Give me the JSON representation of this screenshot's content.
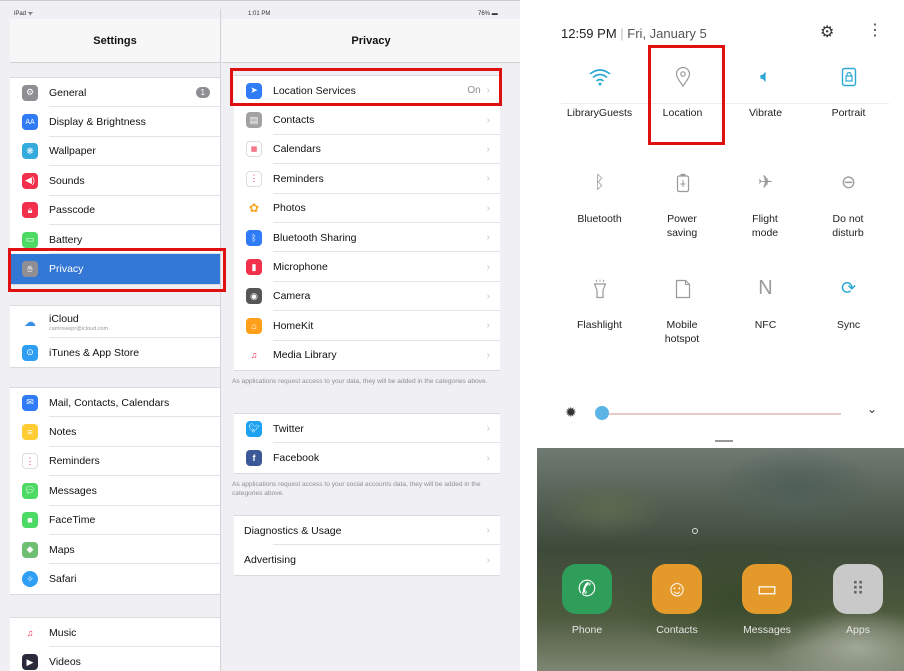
{
  "ipad": {
    "settings": {
      "status_left": "iPad ᯤ",
      "title": "Settings",
      "group1": [
        {
          "label": "General",
          "icon": "gear-icon",
          "color": "#8e8e93",
          "badge": "1"
        },
        {
          "label": "Display & Brightness",
          "icon": "aa-icon",
          "color": "#2f7cf6"
        },
        {
          "label": "Wallpaper",
          "icon": "wallpaper-icon",
          "color": "#35aadc"
        },
        {
          "label": "Sounds",
          "icon": "speaker-icon",
          "color": "#f2304b"
        },
        {
          "label": "Passcode",
          "icon": "lock-icon",
          "color": "#f2304b"
        },
        {
          "label": "Battery",
          "icon": "battery-icon",
          "color": "#4cd964"
        },
        {
          "label": "Privacy",
          "icon": "hand-icon",
          "color": "#8e8e93",
          "selected": true
        }
      ],
      "group2": [
        {
          "label": "iCloud",
          "sub": "camrowepr@icloud.com",
          "icon": "cloud-icon",
          "color": "#ffffff"
        },
        {
          "label": "iTunes & App Store",
          "icon": "app-store-icon",
          "color": "#2f9ff5"
        }
      ],
      "group3": [
        {
          "label": "Mail, Contacts, Calendars",
          "icon": "mail-icon",
          "color": "#2f7cf6"
        },
        {
          "label": "Notes",
          "icon": "notes-icon",
          "color": "#ffcc33"
        },
        {
          "label": "Reminders",
          "icon": "reminders-icon",
          "color": "#ffffff"
        },
        {
          "label": "Messages",
          "icon": "messages-icon",
          "color": "#4cd964"
        },
        {
          "label": "FaceTime",
          "icon": "facetime-icon",
          "color": "#4cd964"
        },
        {
          "label": "Maps",
          "icon": "maps-icon",
          "color": "#6fbf73"
        },
        {
          "label": "Safari",
          "icon": "safari-icon",
          "color": "#2f9ff5"
        }
      ],
      "group4": [
        {
          "label": "Music",
          "icon": "music-icon",
          "color": "#ffffff"
        },
        {
          "label": "Videos",
          "icon": "videos-icon",
          "color": "#2a2a3a"
        }
      ]
    },
    "privacy": {
      "status_time": "1:01 PM",
      "status_battery": "76%",
      "title": "Privacy",
      "group1": [
        {
          "label": "Location Services",
          "value": "On",
          "icon": "location-arrow-icon",
          "color": "#2f7cf6"
        },
        {
          "label": "Contacts",
          "icon": "contacts-icon",
          "color": "#a2a2a2"
        },
        {
          "label": "Calendars",
          "icon": "calendar-icon",
          "color": "#ffffff"
        },
        {
          "label": "Reminders",
          "icon": "reminders-icon",
          "color": "#ffffff"
        },
        {
          "label": "Photos",
          "icon": "photos-icon",
          "color": "#ffffff"
        },
        {
          "label": "Bluetooth Sharing",
          "icon": "bluetooth-icon",
          "color": "#2f7cf6"
        },
        {
          "label": "Microphone",
          "icon": "microphone-icon",
          "color": "#f2304b"
        },
        {
          "label": "Camera",
          "icon": "camera-icon",
          "color": "#555555"
        },
        {
          "label": "HomeKit",
          "icon": "home-icon",
          "color": "#ff9f1a"
        },
        {
          "label": "Media Library",
          "icon": "music-icon",
          "color": "#ffffff"
        }
      ],
      "note1": "As applications request access to your data, they will be added in the categories above.",
      "group2": [
        {
          "label": "Twitter",
          "icon": "twitter-icon",
          "color": "#1da1f2"
        },
        {
          "label": "Facebook",
          "icon": "facebook-icon",
          "color": "#3b5998"
        }
      ],
      "note2": "As applications request access to your social accounts data, they will be added in the categories above.",
      "group3": [
        {
          "label": "Diagnostics & Usage"
        },
        {
          "label": "Advertising"
        }
      ]
    }
  },
  "android": {
    "time": "12:59 PM",
    "date": "Fri, January 5",
    "tiles": [
      {
        "label": "LibraryGuests",
        "icon": "wifi-icon",
        "on": true
      },
      {
        "label": "Location",
        "icon": "location-pin-icon",
        "on": false
      },
      {
        "label": "Vibrate",
        "icon": "vibrate-icon",
        "on": true
      },
      {
        "label": "Portrait",
        "icon": "portrait-lock-icon",
        "on": true
      },
      {
        "label": "Bluetooth",
        "icon": "bluetooth-icon",
        "on": false
      },
      {
        "label": "Power saving",
        "icon": "power-saving-icon",
        "on": false
      },
      {
        "label": "Flight mode",
        "icon": "airplane-icon",
        "on": false
      },
      {
        "label": "Do not disturb",
        "icon": "do-not-disturb-icon",
        "on": false
      },
      {
        "label": "Flashlight",
        "icon": "flashlight-icon",
        "on": false
      },
      {
        "label": "Mobile hotspot",
        "icon": "hotspot-icon",
        "on": false
      },
      {
        "label": "NFC",
        "icon": "nfc-icon",
        "on": false
      },
      {
        "label": "Sync",
        "icon": "sync-icon",
        "on": true
      }
    ],
    "brightness_level": 0.0,
    "dock": [
      {
        "label": "Phone",
        "icon": "phone-icon",
        "color": "#2e9e5a"
      },
      {
        "label": "Contacts",
        "icon": "contacts-icon",
        "color": "#e39a2b"
      },
      {
        "label": "Messages",
        "icon": "messages-icon",
        "color": "#e39a2b"
      },
      {
        "label": "Apps",
        "icon": "apps-grid-icon",
        "color": "#c9c9c9"
      }
    ]
  },
  "colors": {
    "highlight_box": "#e01010",
    "ios_selected": "#3478d5",
    "android_accent": "#2ba8d6"
  }
}
